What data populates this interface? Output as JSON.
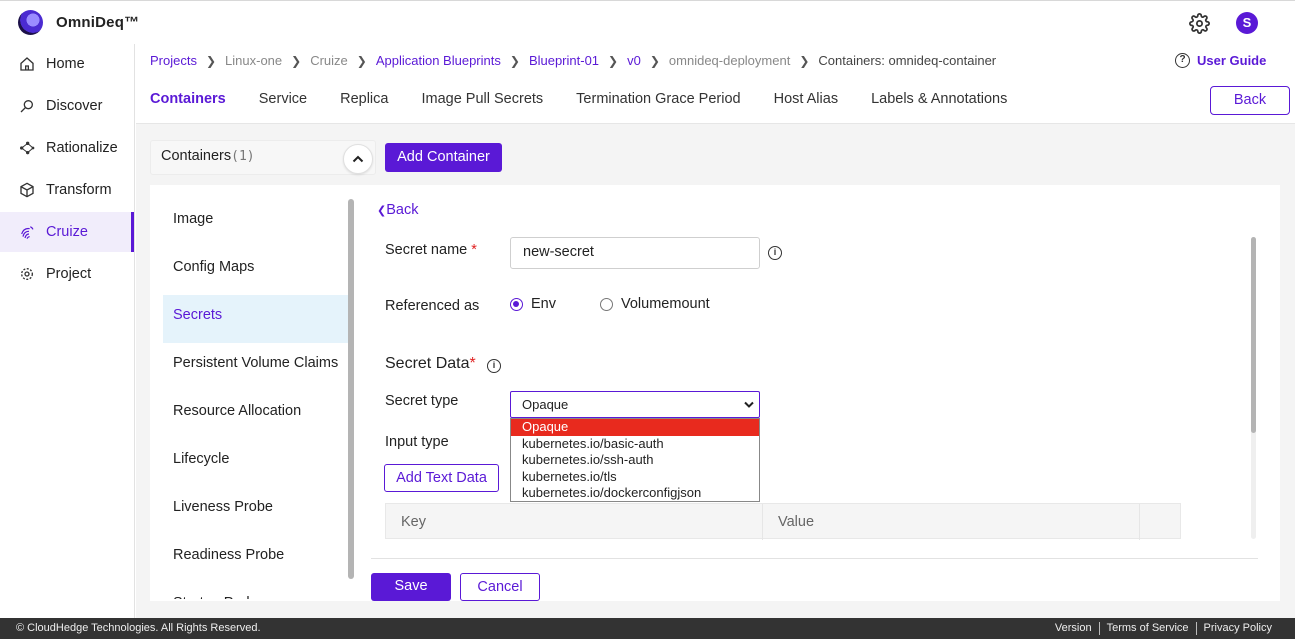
{
  "app": {
    "brand": "OmniDeq™",
    "avatar_letter": "S"
  },
  "sidebar": {
    "items": [
      {
        "label": "Home",
        "icon": "home-icon"
      },
      {
        "label": "Discover",
        "icon": "search-icon"
      },
      {
        "label": "Rationalize",
        "icon": "network-icon"
      },
      {
        "label": "Transform",
        "icon": "cube-icon"
      },
      {
        "label": "Cruize",
        "icon": "fingerprint-icon",
        "active": true
      },
      {
        "label": "Project",
        "icon": "gear-icon"
      }
    ]
  },
  "breadcrumb": [
    "Projects",
    "Linux-one",
    "Cruize",
    "Application Blueprints",
    "Blueprint-01",
    "v0",
    "omnideq-deployment",
    "Containers: omnideq-container"
  ],
  "user_guide": "User Guide",
  "tabs": [
    "Containers",
    "Service",
    "Replica",
    "Image Pull Secrets",
    "Termination Grace Period",
    "Host Alias",
    "Labels & Annotations"
  ],
  "back_label": "Back",
  "containers": {
    "label": "Containers",
    "count": "(1)",
    "add_label": "Add Container"
  },
  "left_list": [
    "Image",
    "Config Maps",
    "Secrets",
    "Persistent Volume Claims",
    "Resource Allocation",
    "Lifecycle",
    "Liveness Probe",
    "Readiness Probe",
    "Startup Probe"
  ],
  "form": {
    "back_link": "Back",
    "secret_name_label": "Secret name",
    "secret_name_value": "new-secret",
    "referenced_as_label": "Referenced as",
    "ref_options": [
      "Env",
      "Volumemount"
    ],
    "secret_data_label": "Secret Data",
    "secret_type_label": "Secret type",
    "secret_type_value": "Opaque",
    "secret_type_options": [
      "Opaque",
      "kubernetes.io/basic-auth",
      "kubernetes.io/ssh-auth",
      "kubernetes.io/tls",
      "kubernetes.io/dockerconfigjson"
    ],
    "input_type_label": "Input type",
    "add_text_label": "Add Text Data",
    "table_headers": [
      "Key",
      "Value"
    ],
    "save_label": "Save",
    "cancel_label": "Cancel"
  },
  "footer": {
    "copyright": "© CloudHedge Technologies. All Rights Reserved.",
    "links": [
      "Version",
      "Terms of Service",
      "Privacy Policy"
    ]
  },
  "colors": {
    "accent": "#5a19d6",
    "selected_option": "#e82a1e"
  }
}
